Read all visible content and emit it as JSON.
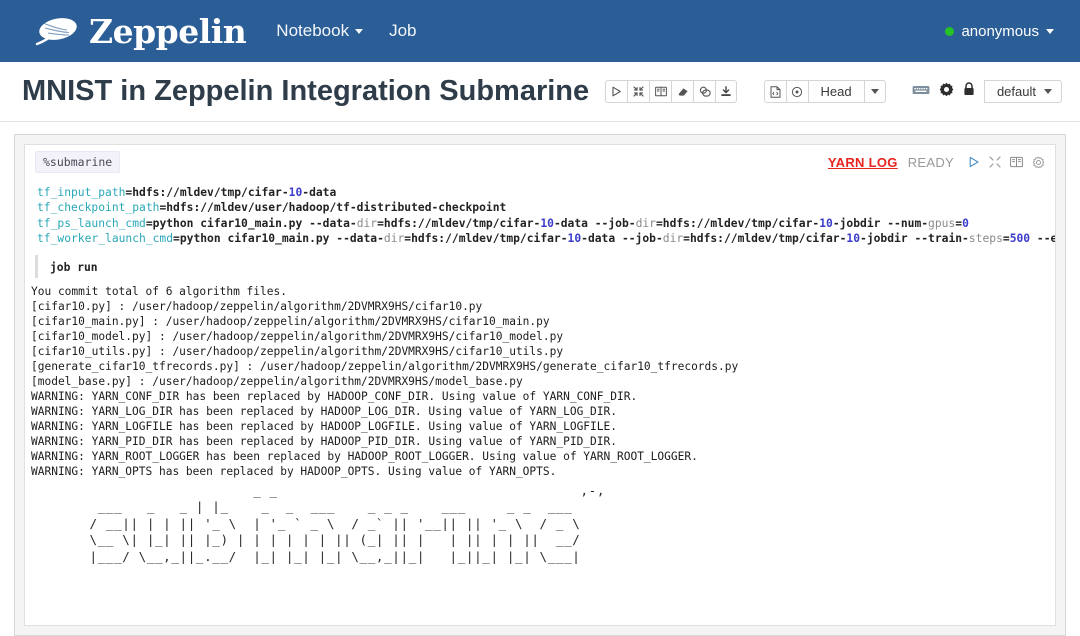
{
  "navbar": {
    "brand_name": "Zeppelin",
    "brand_logo_icon": "zeppelin-logo-icon",
    "links": [
      {
        "label": "Notebook",
        "has_caret": true
      },
      {
        "label": "Job",
        "has_caret": false
      }
    ],
    "user": {
      "label": "anonymous",
      "status_dot_color": "#25c325",
      "has_caret": true
    },
    "background_color": "#2b5d96"
  },
  "titlebar": {
    "title": "MNIST in Zeppelin Integration Submarine",
    "run_group": [
      {
        "icon": "play-icon",
        "label": ""
      },
      {
        "icon": "collapse-icon",
        "label": ""
      },
      {
        "icon": "book-icon",
        "label": ""
      },
      {
        "icon": "eraser-icon",
        "label": ""
      },
      {
        "icon": "clone-icon",
        "label": ""
      },
      {
        "icon": "export-download-icon",
        "label": ""
      }
    ],
    "version_group": [
      {
        "icon": "code-file-icon",
        "label": ""
      },
      {
        "icon": "clock-history-icon",
        "label": ""
      },
      {
        "icon": "",
        "label": "Head"
      },
      {
        "icon": "chevron-down-icon",
        "label": ""
      }
    ],
    "settings_icons": [
      {
        "icon": "keyboard-icon"
      },
      {
        "icon": "gear-icon"
      },
      {
        "icon": "lock-icon"
      }
    ],
    "interpreter_select": {
      "label": "default",
      "has_caret": true
    }
  },
  "paragraph": {
    "interpreter_directive": "%submarine",
    "yarn_log_label": "YARN LOG",
    "status_label": "READY",
    "status_color": "#999999",
    "yarn_log_color": "#e8241f",
    "action_icons": [
      {
        "icon": "play-icon"
      },
      {
        "icon": "collapse-icon"
      },
      {
        "icon": "book-icon"
      },
      {
        "icon": "gear-icon"
      }
    ],
    "code_lines": [
      [
        {
          "t": "tf_input_path",
          "c": "var"
        },
        {
          "t": "=",
          "c": "val"
        },
        {
          "t": "hdfs://mldev/tmp/cifar-",
          "c": "val"
        },
        {
          "t": "10",
          "c": "num"
        },
        {
          "t": "-data",
          "c": "val"
        }
      ],
      [
        {
          "t": "tf_checkpoint_path",
          "c": "var"
        },
        {
          "t": "=",
          "c": "val"
        },
        {
          "t": "hdfs://mldev/user/hadoop/tf-distributed-checkpoint",
          "c": "val"
        }
      ],
      [
        {
          "t": "tf_ps_launch_cmd",
          "c": "var"
        },
        {
          "t": "=",
          "c": "val"
        },
        {
          "t": "python cifar10_main.py ",
          "c": "val"
        },
        {
          "t": "--data-",
          "c": "val"
        },
        {
          "t": "dir",
          "c": "sub"
        },
        {
          "t": "=hdfs://mldev/tmp/cifar-",
          "c": "val"
        },
        {
          "t": "10",
          "c": "num"
        },
        {
          "t": "-data ",
          "c": "val"
        },
        {
          "t": "--job-",
          "c": "val"
        },
        {
          "t": "dir",
          "c": "sub"
        },
        {
          "t": "=hdfs://mldev/tmp/cifar-",
          "c": "val"
        },
        {
          "t": "10",
          "c": "num"
        },
        {
          "t": "-jobdir ",
          "c": "val"
        },
        {
          "t": "--num-",
          "c": "val"
        },
        {
          "t": "gpus",
          "c": "sub"
        },
        {
          "t": "=",
          "c": "val"
        },
        {
          "t": "0",
          "c": "num"
        }
      ],
      [
        {
          "t": "tf_worker_launch_cmd",
          "c": "var"
        },
        {
          "t": "=",
          "c": "val"
        },
        {
          "t": "python cifar10_main.py ",
          "c": "val"
        },
        {
          "t": "--data-",
          "c": "val"
        },
        {
          "t": "dir",
          "c": "sub"
        },
        {
          "t": "=hdfs://mldev/tmp/cifar-",
          "c": "val"
        },
        {
          "t": "10",
          "c": "num"
        },
        {
          "t": "-data ",
          "c": "val"
        },
        {
          "t": "--job-",
          "c": "val"
        },
        {
          "t": "dir",
          "c": "sub"
        },
        {
          "t": "=hdfs://mldev/tmp/cifar-",
          "c": "val"
        },
        {
          "t": "10",
          "c": "num"
        },
        {
          "t": "-jobdir ",
          "c": "val"
        },
        {
          "t": "--train-",
          "c": "val"
        },
        {
          "t": "steps",
          "c": "sub"
        },
        {
          "t": "=",
          "c": "val"
        },
        {
          "t": "500",
          "c": "num"
        },
        {
          "t": " --eval-bat",
          "c": "val"
        }
      ]
    ],
    "job_run_line": "job run",
    "output_lines": [
      "You commit total of 6 algorithm files.",
      "[cifar10.py] : /user/hadoop/zeppelin/algorithm/2DVMRX9HS/cifar10.py",
      "[cifar10_main.py] : /user/hadoop/zeppelin/algorithm/2DVMRX9HS/cifar10_main.py",
      "[cifar10_model.py] : /user/hadoop/zeppelin/algorithm/2DVMRX9HS/cifar10_model.py",
      "[cifar10_utils.py] : /user/hadoop/zeppelin/algorithm/2DVMRX9HS/cifar10_utils.py",
      "[generate_cifar10_tfrecords.py] : /user/hadoop/zeppelin/algorithm/2DVMRX9HS/generate_cifar10_tfrecords.py",
      "[model_base.py] : /user/hadoop/zeppelin/algorithm/2DVMRX9HS/model_base.py",
      "WARNING: YARN_CONF_DIR has been replaced by HADOOP_CONF_DIR. Using value of YARN_CONF_DIR.",
      "WARNING: YARN_LOG_DIR has been replaced by HADOOP_LOG_DIR. Using value of YARN_LOG_DIR.",
      "WARNING: YARN_LOGFILE has been replaced by HADOOP_LOGFILE. Using value of YARN_LOGFILE.",
      "WARNING: YARN_PID_DIR has been replaced by HADOOP_PID_DIR. Using value of YARN_PID_DIR.",
      "WARNING: YARN_ROOT_LOGGER has been replaced by HADOOP_ROOT_LOGGER. Using value of YARN_ROOT_LOGGER.",
      "WARNING: YARN_OPTS has been replaced by HADOOP_OPTS. Using value of YARN_OPTS."
    ],
    "ascii_banner": "                       _ _                                     ,-,\n    ___   _   _ | |_    _  _  ___    _ _ _    ___     _ _  ___\n   / __|| | | || '_ \\  | '_ ` _ \\  / _` || '__|| || '_ \\  / _ \\\n   \\__ \\| |_| || |_) | | | | | | || (_| || |   | || | | ||  __/\n   |___/ \\__,_||_.__/  |_| |_| |_| \\__,_||_|   |_||_| |_| \\___|"
  }
}
